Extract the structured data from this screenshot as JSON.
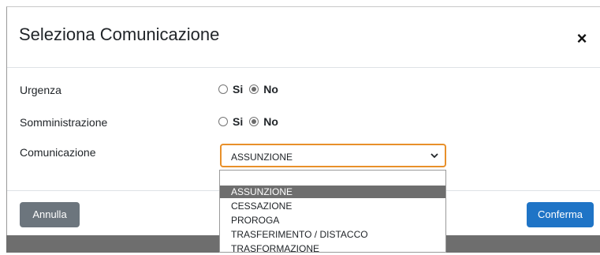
{
  "dialog": {
    "title": "Seleziona Comunicazione",
    "close_label": "×"
  },
  "form": {
    "urgenza": {
      "label": "Urgenza",
      "options": [
        "Si",
        "No"
      ],
      "selected": "No"
    },
    "somministrazione": {
      "label": "Somministrazione",
      "options": [
        "Si",
        "No"
      ],
      "selected": "No"
    },
    "comunicazione": {
      "label": "Comunicazione",
      "value": "ASSUNZIONE",
      "options": [
        "ASSUNZIONE",
        "CESSAZIONE",
        "PROROGA",
        "TRASFERIMENTO / DISTACCO",
        "TRASFORMAZIONE"
      ],
      "highlighted": "ASSUNZIONE"
    }
  },
  "footer": {
    "cancel_label": "Annulla",
    "confirm_label": "Conferma"
  },
  "colors": {
    "focus_border": "#e8902a",
    "confirm": "#1f74c6",
    "cancel": "#6c757d",
    "highlight": "#6e6e6e"
  },
  "icons": {
    "close": "close-icon",
    "dropdown": "chevron-down-icon"
  }
}
